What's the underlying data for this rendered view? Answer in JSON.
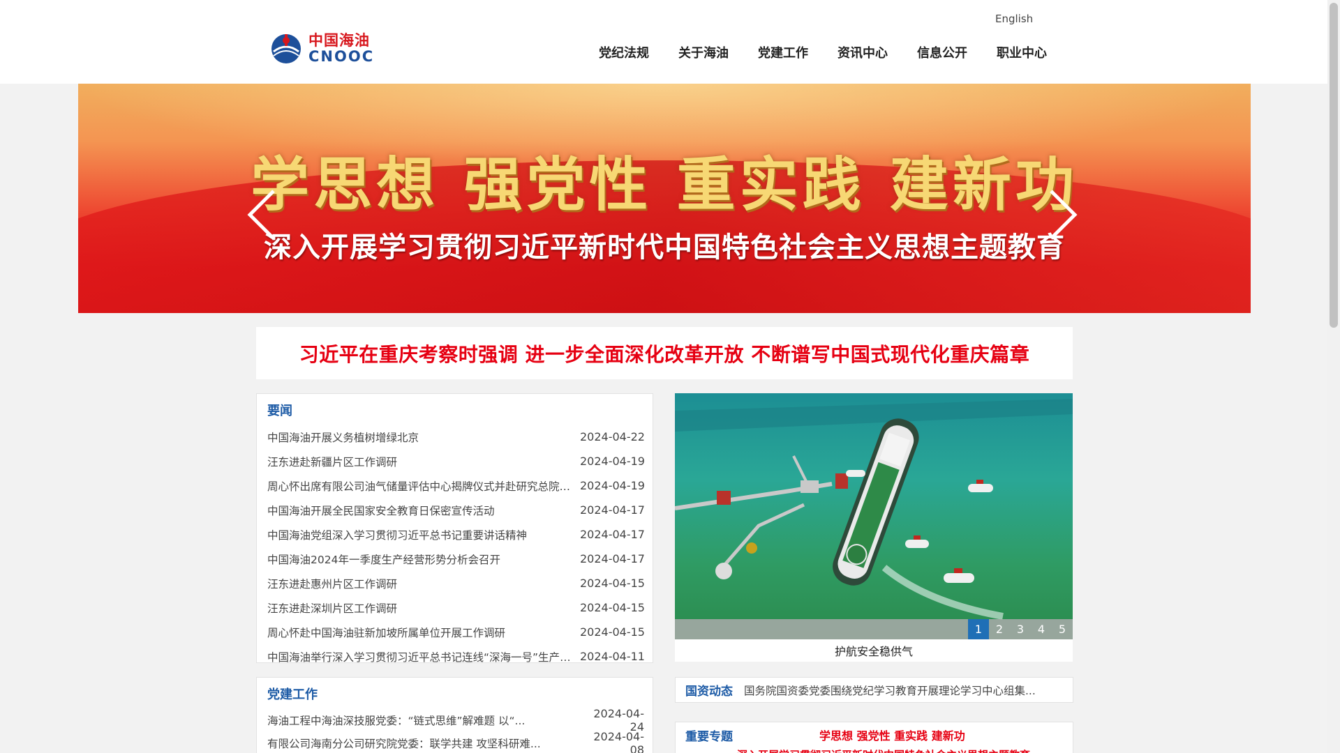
{
  "header": {
    "language_link": "English",
    "logo": {
      "cn": "中国海油",
      "en": "CNOOC",
      "mark_text": "CNOOC"
    },
    "nav": [
      "党纪法规",
      "关于海油",
      "党建工作",
      "资讯中心",
      "信息公开",
      "职业中心"
    ]
  },
  "banner": {
    "title": "学思想 强党性 重实践 建新功",
    "subtitle": "深入开展学习贯彻习近平新时代中国特色社会主义思想主题教育"
  },
  "headline": "习近平在重庆考察时强调 进一步全面深化改革开放 不断谱写中国式现代化重庆篇章",
  "news": {
    "title": "要闻",
    "items": [
      {
        "title": "中国海油开展义务植树增绿北京",
        "date": "2024-04-22"
      },
      {
        "title": "汪东进赴新疆片区工作调研",
        "date": "2024-04-19"
      },
      {
        "title": "周心怀出席有限公司油气储量评估中心揭牌仪式并赴研究总院调研",
        "date": "2024-04-19"
      },
      {
        "title": "中国海油开展全民国家安全教育日保密宣传活动",
        "date": "2024-04-17"
      },
      {
        "title": "中国海油党组深入学习贯彻习近平总书记重要讲话精神",
        "date": "2024-04-17"
      },
      {
        "title": "中国海油2024年一季度生产经营形势分析会召开",
        "date": "2024-04-17"
      },
      {
        "title": "汪东进赴惠州片区工作调研",
        "date": "2024-04-15"
      },
      {
        "title": "汪东进赴深圳片区工作调研",
        "date": "2024-04-15"
      },
      {
        "title": "周心怀赴中国海油驻新加坡所属单位开展工作调研",
        "date": "2024-04-15"
      },
      {
        "title": "中国海油举行深入学习贯彻习近平总书记连线“深海一号”生产平台重要讲话精神座谈会",
        "date": "2024-04-11"
      }
    ]
  },
  "photo_carousel": {
    "caption": "护航安全稳供气",
    "pages": [
      "1",
      "2",
      "3",
      "4",
      "5"
    ],
    "active_page": 1
  },
  "party_work": {
    "title": "党建工作",
    "items": [
      {
        "title": "海油工程中海油深技服党委：“链式思维”解难题 以“...",
        "date": "2024-04-24"
      },
      {
        "title": "有限公司海南分公司研究院党委：联学共建 攻坚科研难...",
        "date": "2024-04-08"
      }
    ]
  },
  "sasac_news": {
    "label": "国资动态",
    "text": "国务院国资委党委围绕党纪学习教育开展理论学习中心组集..."
  },
  "topics": {
    "label": "重要专题",
    "line1": "学思想 强党性 重实践 建新功",
    "line2": "深入开展学习贯彻习近平新时代中国特色社会主义思想主题教育"
  },
  "colors": {
    "accent_blue": "#1d5ba6",
    "headline_red": "#e60012",
    "brand_red": "#d7161c"
  }
}
